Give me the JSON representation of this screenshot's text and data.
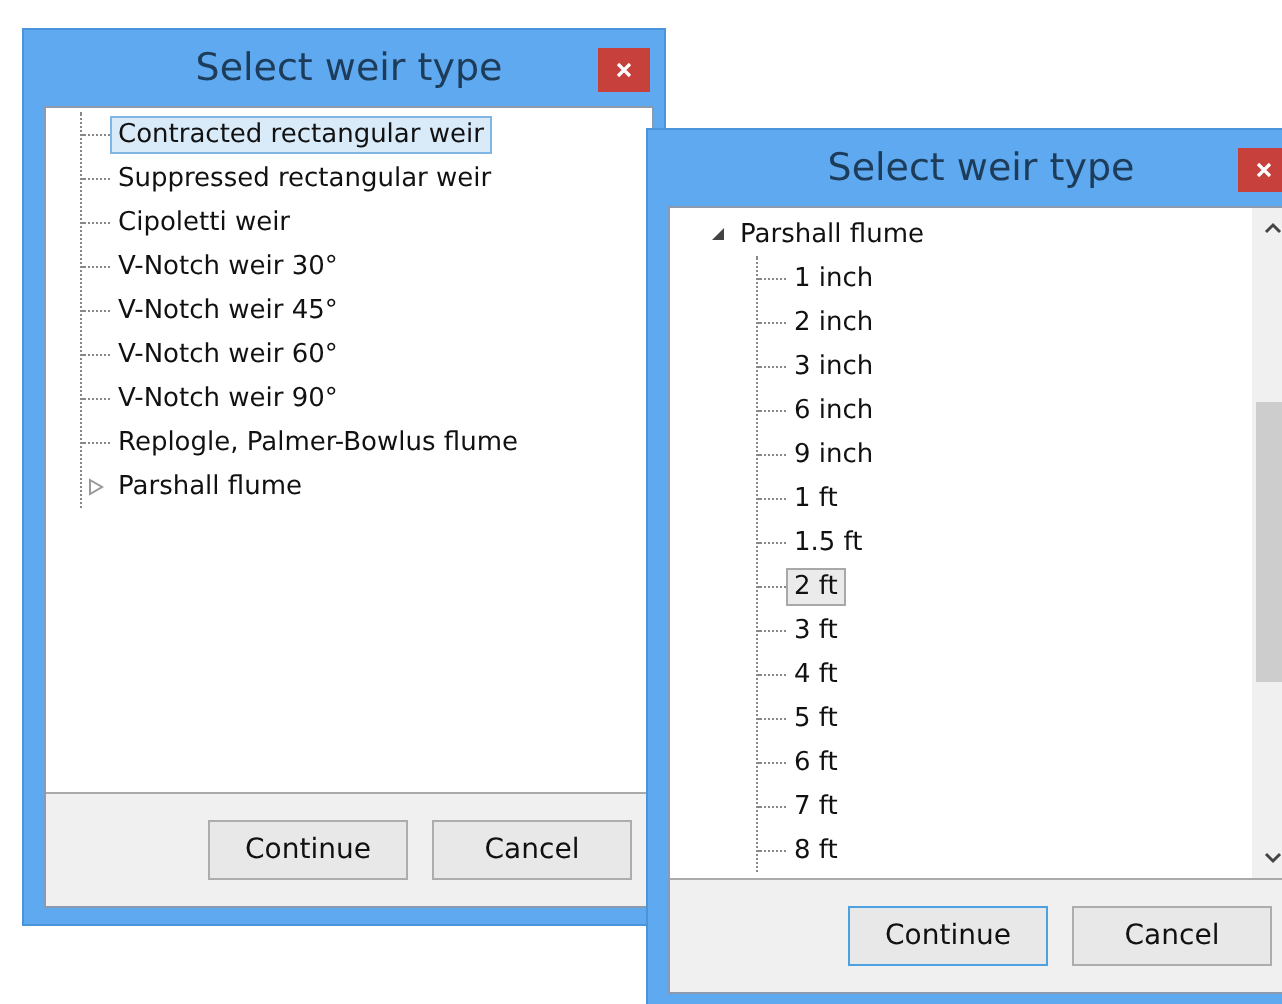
{
  "windows": [
    {
      "title": "Select weir type",
      "tree": [
        {
          "label": "Contracted rectangular weir",
          "selected": true
        },
        {
          "label": "Suppressed rectangular weir",
          "selected": false
        },
        {
          "label": "Cipoletti weir",
          "selected": false
        },
        {
          "label": "V-Notch weir 30°",
          "selected": false
        },
        {
          "label": "V-Notch weir 45°",
          "selected": false
        },
        {
          "label": "V-Notch weir 60°",
          "selected": false
        },
        {
          "label": "V-Notch weir 90°",
          "selected": false
        },
        {
          "label": "Replogle, Palmer-Bowlus flume",
          "selected": false
        },
        {
          "label": "Parshall flume",
          "selected": false,
          "expanded": false
        }
      ],
      "buttons": [
        {
          "label": "Continue",
          "focused": false
        },
        {
          "label": "Cancel",
          "focused": false
        }
      ]
    },
    {
      "title": "Select weir type",
      "tree": [
        {
          "label": "Parshall flume",
          "selected": false,
          "expanded": true,
          "children": [
            {
              "label": "1 inch",
              "selected": false
            },
            {
              "label": "2 inch",
              "selected": false
            },
            {
              "label": "3 inch",
              "selected": false
            },
            {
              "label": "6 inch",
              "selected": false
            },
            {
              "label": "9 inch",
              "selected": false
            },
            {
              "label": "1 ft",
              "selected": false
            },
            {
              "label": "1.5 ft",
              "selected": false
            },
            {
              "label": "2 ft",
              "selected": true
            },
            {
              "label": "3 ft",
              "selected": false
            },
            {
              "label": "4 ft",
              "selected": false
            },
            {
              "label": "5 ft",
              "selected": false
            },
            {
              "label": "6 ft",
              "selected": false
            },
            {
              "label": "7 ft",
              "selected": false
            },
            {
              "label": "8 ft",
              "selected": false
            }
          ]
        }
      ],
      "scrollbar": true,
      "buttons": [
        {
          "label": "Continue",
          "focused": true
        },
        {
          "label": "Cancel",
          "focused": false
        }
      ]
    }
  ]
}
